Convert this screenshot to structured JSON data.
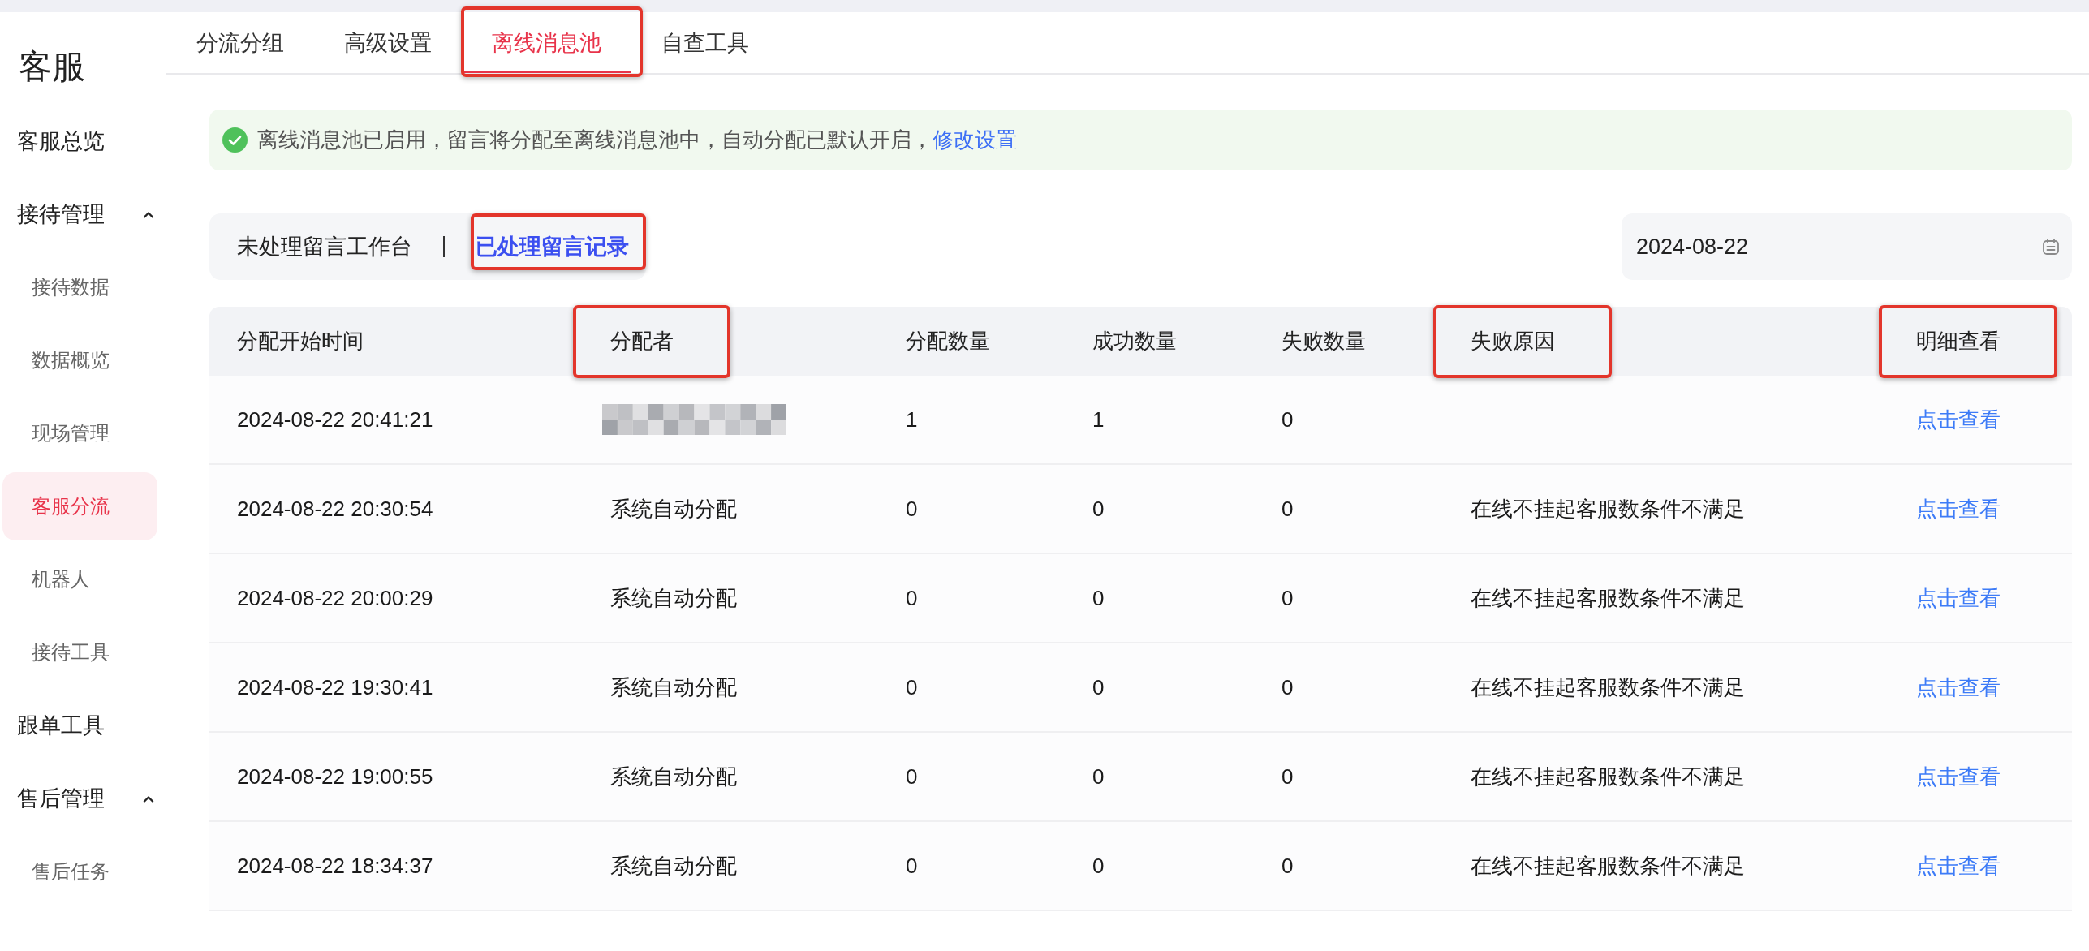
{
  "sidebar": {
    "title": "客服",
    "items": [
      {
        "label": "客服总览",
        "selected": false
      },
      {
        "label": "接待管理",
        "selected": false,
        "expanded": true,
        "children": [
          {
            "label": "接待数据",
            "selected": false
          },
          {
            "label": "数据概览",
            "selected": false
          },
          {
            "label": "现场管理",
            "selected": false
          },
          {
            "label": "客服分流",
            "selected": true
          },
          {
            "label": "机器人",
            "selected": false
          },
          {
            "label": "接待工具",
            "selected": false
          }
        ]
      },
      {
        "label": "跟单工具",
        "selected": false
      },
      {
        "label": "售后管理",
        "selected": false,
        "expanded": true,
        "children": [
          {
            "label": "售后任务",
            "selected": false
          }
        ]
      }
    ]
  },
  "tabs": [
    {
      "label": "分流分组",
      "selected": false,
      "highlighted": false
    },
    {
      "label": "高级设置",
      "selected": false,
      "highlighted": false
    },
    {
      "label": "离线消息池",
      "selected": true,
      "highlighted": true
    },
    {
      "label": "自查工具",
      "selected": false,
      "highlighted": false
    }
  ],
  "notice": {
    "text": "离线消息池已启用，留言将分配至离线消息池中，自动分配已默认开启，",
    "link": "修改设置"
  },
  "record_switch": [
    {
      "label": "未处理留言工作台",
      "selected": false,
      "highlighted": false
    },
    {
      "label": "已处理留言记录",
      "selected": true,
      "highlighted": true
    }
  ],
  "date_field": {
    "value": "2024-08-22"
  },
  "table": {
    "columns": [
      {
        "label": "分配开始时间",
        "highlighted": false
      },
      {
        "label": "分配者",
        "highlighted": true
      },
      {
        "label": "分配数量",
        "highlighted": false
      },
      {
        "label": "成功数量",
        "highlighted": false
      },
      {
        "label": "失败数量",
        "highlighted": false
      },
      {
        "label": "失败原因",
        "highlighted": true
      },
      {
        "label": "明细查看",
        "highlighted": true
      }
    ],
    "rows": [
      {
        "start_time": "2024-08-22 20:41:21",
        "assigner": {
          "kind": "blurred"
        },
        "assigned": "1",
        "succeeded": "1",
        "failed": "0",
        "action": "点击查看"
      },
      {
        "start_time": "2024-08-22 20:30:54",
        "assigner": {
          "kind": "text",
          "text": "系统自动分配"
        },
        "assigned": "0",
        "succeeded": "0",
        "failed": "0",
        "reason": "在线不挂起客服数条件不满足",
        "action": "点击查看"
      },
      {
        "start_time": "2024-08-22 20:00:29",
        "assigner": {
          "kind": "text",
          "text": "系统自动分配"
        },
        "assigned": "0",
        "succeeded": "0",
        "failed": "0",
        "reason": "在线不挂起客服数条件不满足",
        "action": "点击查看"
      },
      {
        "start_time": "2024-08-22 19:30:41",
        "assigner": {
          "kind": "text",
          "text": "系统自动分配"
        },
        "assigned": "0",
        "succeeded": "0",
        "failed": "0",
        "reason": "在线不挂起客服数条件不满足",
        "action": "点击查看"
      },
      {
        "start_time": "2024-08-22 19:00:55",
        "assigner": {
          "kind": "text",
          "text": "系统自动分配"
        },
        "assigned": "0",
        "succeeded": "0",
        "failed": "0",
        "reason": "在线不挂起客服数条件不满足",
        "action": "点击查看"
      },
      {
        "start_time": "2024-08-22 18:34:37",
        "assigner": {
          "kind": "text",
          "text": "系统自动分配"
        },
        "assigned": "0",
        "succeeded": "0",
        "failed": "0",
        "reason": "在线不挂起客服数条件不满足",
        "action": "点击查看"
      }
    ]
  }
}
